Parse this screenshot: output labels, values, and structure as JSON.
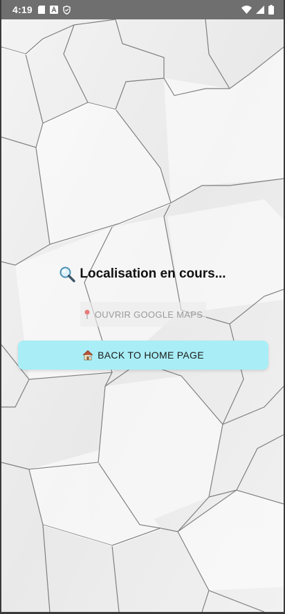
{
  "status_bar": {
    "time": "4:19",
    "left_icons": [
      "sd-card-icon",
      "a-notification-icon",
      "shield-icon"
    ],
    "right_icons": [
      "wifi-icon",
      "cell-signal-icon",
      "battery-icon"
    ]
  },
  "main": {
    "status_title": "Localisation en cours...",
    "status_icon": "magnifier-icon",
    "maps_button_label": "OUVRIR GOOGLE MAPS",
    "maps_button_icon": "pin-icon",
    "maps_button_state": "disabled",
    "home_button_label": "BACK TO HOME PAGE",
    "home_button_icon": "house-icon"
  },
  "colors": {
    "status_bar": "#6f6f6f",
    "background": "#efefef",
    "home_button": "#a9eef6",
    "disabled_text": "#9a9a9a"
  }
}
